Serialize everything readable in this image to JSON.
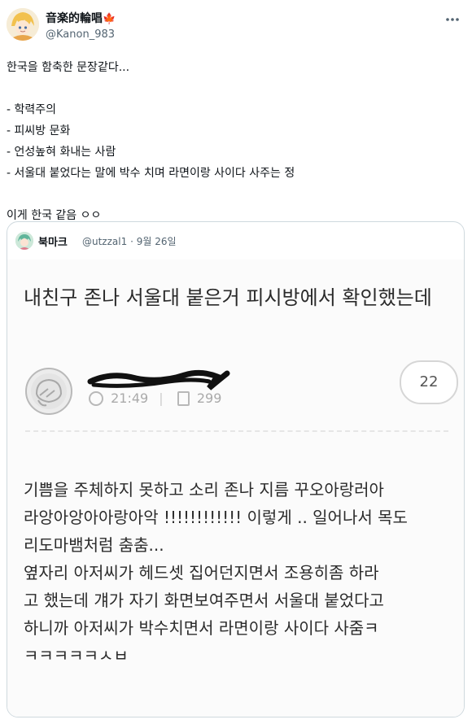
{
  "tweet": {
    "display_name": "音楽的輪唱",
    "flag": "🍁",
    "handle": "@Kanon_983",
    "more_icon": "more-horizontal-icon",
    "body_lines": [
      "한국을 함축한 문장같다...",
      "",
      "- 학력주의",
      "- 피씨방 문화",
      "- 언성높혀 화내는 사람",
      "- 서울대 붙었다는 말에 박수 치며 라면이랑 사이다 사주는 정",
      "",
      "이게 한국 같음 ㅇㅇ"
    ]
  },
  "quote": {
    "display_name": "북마크",
    "handle": "@utzzal1",
    "separator": "·",
    "date": "9월 26일",
    "post": {
      "title": "내친구 존나 서울대 붙은거 피시방에서 확인했는데",
      "time": "21:49",
      "views": "299",
      "comment_count": "22",
      "content_lines": [
        "기쁨을 주체하지 못하고 소리 존나 지름 꾸오아랑러아",
        "라앙아앙아아랑아악 !!!!!!!!!!!! 이렇게 .. 일어나서 목도",
        "리도마뱀처럼 춤춤...",
        "옆자리 아저씨가 헤드셋 집어던지면서 조용히좀 하라",
        "고 했는데 걔가 자기 화면보여주면서 서울대 붙었다고",
        "하니까 아저씨가 박수치면서 라면이랑 사이다 사줌ㅋ",
        "ㅋㅋㅋㅋㅋㅅㅂ"
      ]
    }
  }
}
